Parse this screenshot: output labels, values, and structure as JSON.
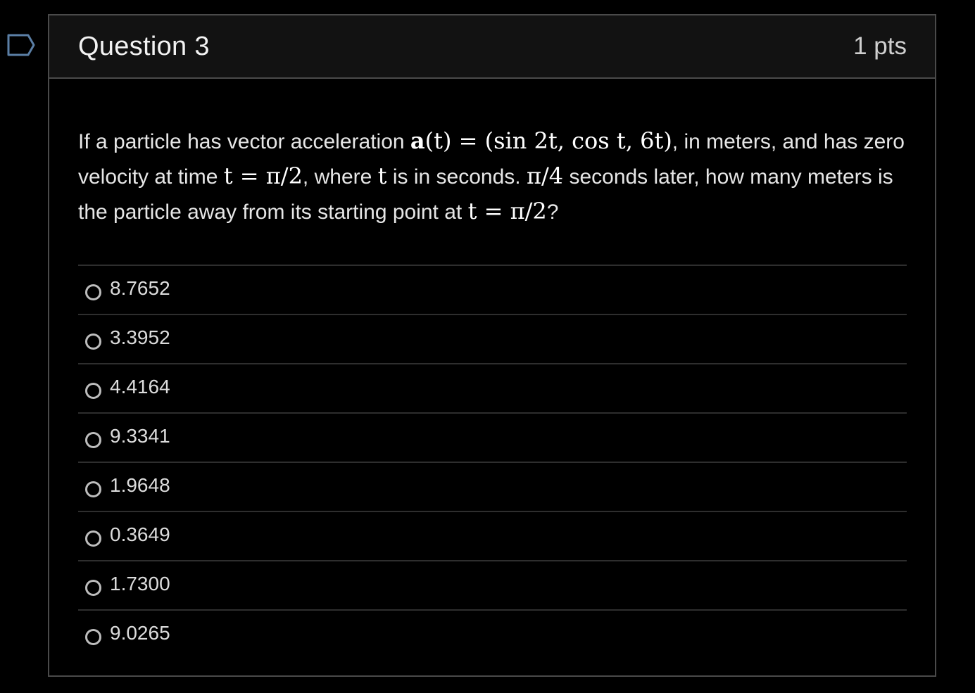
{
  "flag_icon": "bookmark-flag-icon",
  "question": {
    "title": "Question 3",
    "points": "1 pts",
    "text_parts": {
      "p1": "If a particle has vector acceleration ",
      "m1_bold": "a",
      "m1_rest": "(t) = (sin 2t, cos t, 6t)",
      "p2": ", in meters, and has zero velocity at time ",
      "m2": "t = π/2",
      "p3": ", where ",
      "m3": "t",
      "p4": " is in seconds. ",
      "m4": "π/4",
      "p5": " seconds later, how many meters is the particle away from its starting point at ",
      "m5": "t = π/2",
      "p6": "?"
    },
    "answers": [
      "8.7652",
      "3.3952",
      "4.4164",
      "9.3341",
      "1.9648",
      "0.3649",
      "1.7300",
      "9.0265"
    ]
  },
  "colors": {
    "background": "#000000",
    "header_bg": "#121212",
    "border": "#4a4a4a",
    "divider": "#2e2e2e",
    "flag": "#5b7fa6"
  }
}
